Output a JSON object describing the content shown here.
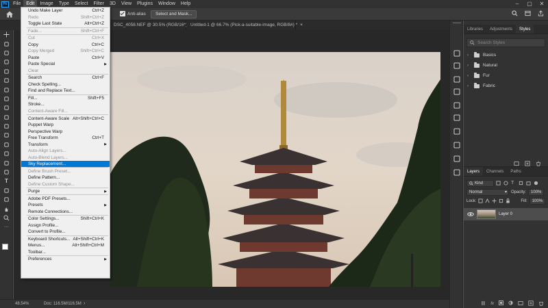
{
  "app": {
    "logo": "Ps"
  },
  "menubar": {
    "items": [
      "File",
      "Edit",
      "Image",
      "Type",
      "Select",
      "Filter",
      "3D",
      "View",
      "Plugins",
      "Window",
      "Help"
    ],
    "active": "Edit"
  },
  "options": {
    "anti_alias": "Anti-alias",
    "select_mask": "Select and Mask..."
  },
  "tabs": [
    {
      "label": "DSC_4058.NEF @ 30.5% (RGB/16*)",
      "close": "×",
      "active": false
    },
    {
      "label": "Untitled-1 @ 66.7% (Pick-a-suitable-image, RGB/8#) *",
      "close": "×",
      "active": false
    }
  ],
  "status": {
    "zoom": "48.54%",
    "doc": "Doc: 116.5M/116.5M",
    "arrow": "›"
  },
  "edit_menu": {
    "items": [
      {
        "label": "Undo Make Layer",
        "shortcut": "Ctrl+Z",
        "disabled": false
      },
      {
        "label": "Redo",
        "shortcut": "Shift+Ctrl+Z",
        "disabled": true
      },
      {
        "label": "Toggle Last State",
        "shortcut": "Alt+Ctrl+Z",
        "disabled": false
      },
      {
        "sep": true
      },
      {
        "label": "Fade...",
        "shortcut": "Shift+Ctrl+F",
        "disabled": true
      },
      {
        "sep": true
      },
      {
        "label": "Cut",
        "shortcut": "Ctrl+X",
        "disabled": true
      },
      {
        "label": "Copy",
        "shortcut": "Ctrl+C",
        "disabled": false
      },
      {
        "label": "Copy Merged",
        "shortcut": "Shift+Ctrl+C",
        "disabled": true
      },
      {
        "label": "Paste",
        "shortcut": "Ctrl+V",
        "disabled": false
      },
      {
        "label": "Paste Special",
        "shortcut": "",
        "disabled": false,
        "submenu": true
      },
      {
        "label": "Clear",
        "shortcut": "",
        "disabled": true
      },
      {
        "sep": true
      },
      {
        "label": "Search",
        "shortcut": "Ctrl+F",
        "disabled": false
      },
      {
        "label": "Check Spelling...",
        "shortcut": "",
        "disabled": false
      },
      {
        "label": "Find and Replace Text...",
        "shortcut": "",
        "disabled": false
      },
      {
        "sep": true
      },
      {
        "label": "Fill...",
        "shortcut": "Shift+F5",
        "disabled": false
      },
      {
        "label": "Stroke...",
        "shortcut": "",
        "disabled": false
      },
      {
        "label": "Content-Aware Fill...",
        "shortcut": "",
        "disabled": true
      },
      {
        "sep": true
      },
      {
        "label": "Content-Aware Scale",
        "shortcut": "Alt+Shift+Ctrl+C",
        "disabled": false
      },
      {
        "label": "Puppet Warp",
        "shortcut": "",
        "disabled": false
      },
      {
        "label": "Perspective Warp",
        "shortcut": "",
        "disabled": false
      },
      {
        "label": "Free Transform",
        "shortcut": "Ctrl+T",
        "disabled": false
      },
      {
        "label": "Transform",
        "shortcut": "",
        "disabled": false,
        "submenu": true
      },
      {
        "label": "Auto-Align Layers...",
        "shortcut": "",
        "disabled": true
      },
      {
        "label": "Auto-Blend Layers...",
        "shortcut": "",
        "disabled": true
      },
      {
        "label": "Sky Replacement...",
        "shortcut": "",
        "disabled": false,
        "highlight": true
      },
      {
        "sep": true
      },
      {
        "label": "Define Brush Preset...",
        "shortcut": "",
        "disabled": true
      },
      {
        "label": "Define Pattern...",
        "shortcut": "",
        "disabled": false
      },
      {
        "label": "Define Custom Shape...",
        "shortcut": "",
        "disabled": true
      },
      {
        "sep": true
      },
      {
        "label": "Purge",
        "shortcut": "",
        "disabled": false,
        "submenu": true
      },
      {
        "sep": true
      },
      {
        "label": "Adobe PDF Presets...",
        "shortcut": "",
        "disabled": false
      },
      {
        "label": "Presets",
        "shortcut": "",
        "disabled": false,
        "submenu": true
      },
      {
        "label": "Remote Connections...",
        "shortcut": "",
        "disabled": false
      },
      {
        "sep": true
      },
      {
        "label": "Color Settings...",
        "shortcut": "Shift+Ctrl+K",
        "disabled": false
      },
      {
        "label": "Assign Profile...",
        "shortcut": "",
        "disabled": false
      },
      {
        "label": "Convert to Profile...",
        "shortcut": "",
        "disabled": false
      },
      {
        "sep": true
      },
      {
        "label": "Keyboard Shortcuts...",
        "shortcut": "Alt+Shift+Ctrl+K",
        "disabled": false
      },
      {
        "label": "Menus...",
        "shortcut": "Alt+Shift+Ctrl+M",
        "disabled": false
      },
      {
        "label": "Toolbar...",
        "shortcut": "",
        "disabled": false
      },
      {
        "sep": true
      },
      {
        "label": "Preferences",
        "shortcut": "",
        "disabled": false,
        "submenu": true
      }
    ]
  },
  "styles_panel": {
    "tabs": [
      "Libraries",
      "Adjustments",
      "Styles"
    ],
    "active_tab": "Styles",
    "search_placeholder": "Search Styles",
    "groups": [
      "Basics",
      "Natural",
      "Fur",
      "Fabric"
    ]
  },
  "layers_panel": {
    "tabs": [
      "Layers",
      "Channels",
      "Paths"
    ],
    "active_tab": "Layers",
    "filter": "Kind",
    "blend_mode": "Normal",
    "opacity_label": "Opacity:",
    "opacity": "100%",
    "lock_label": "Lock:",
    "fill_label": "Fill:",
    "fill": "100%",
    "layers": [
      {
        "name": "Layer 0"
      }
    ],
    "footer_fx": "fx"
  },
  "colors": {
    "menu_highlight": "#0078d7",
    "ps_blue": "#31a8ff",
    "app_bg": "#323232"
  }
}
